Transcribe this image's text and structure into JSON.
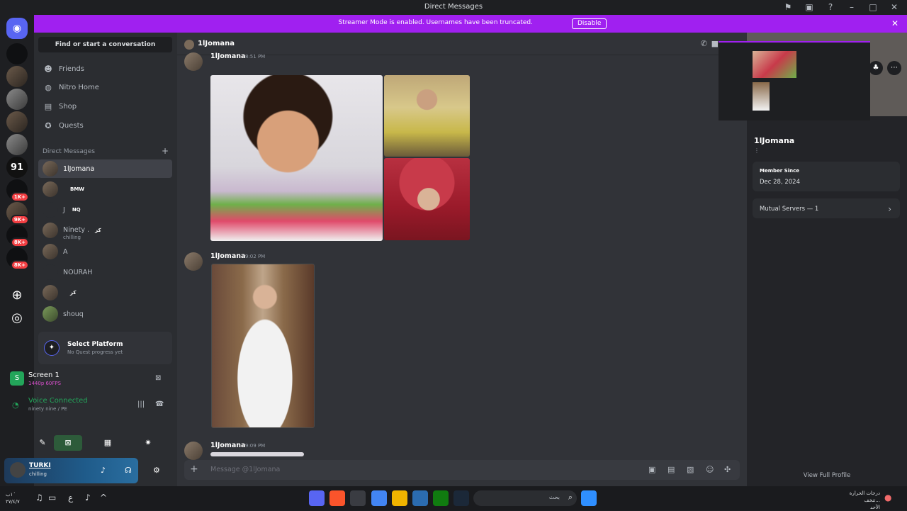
{
  "window": {
    "title": "Direct Messages"
  },
  "banner": {
    "message": "Streamer Mode is enabled. Usernames have been truncated.",
    "disable_label": "Disable"
  },
  "servers": {
    "badges": [
      "1K+",
      "9K+",
      "8K+",
      "8K+"
    ],
    "number_server": "91"
  },
  "sidebar": {
    "search_label": "Find or start a conversation",
    "nav": [
      {
        "label": "Friends",
        "icon": "friends-icon"
      },
      {
        "label": "Nitro Home",
        "icon": "nitro-icon"
      },
      {
        "label": "Shop",
        "icon": "shop-icon"
      },
      {
        "label": "Quests",
        "icon": "quests-icon"
      }
    ],
    "dm_header": "Direct Messages",
    "dms": [
      {
        "name": "1lJomana",
        "tag": "",
        "sub": ""
      },
      {
        "name": "",
        "tag": "BMW",
        "sub": ""
      },
      {
        "name": "J",
        "tag": "NQ",
        "sub": ""
      },
      {
        "name": "Ninety .",
        "tag": "كز",
        "sub": "chilling"
      },
      {
        "name": "A",
        "tag": "",
        "sub": ""
      },
      {
        "name": "NOURAH",
        "tag": "",
        "sub": ""
      },
      {
        "name": "",
        "tag": "كز",
        "sub": ""
      },
      {
        "name": "shouq",
        "tag": "",
        "sub": ""
      }
    ]
  },
  "quest": {
    "title": "Select Platform",
    "subtitle": "No Quest progress yet"
  },
  "stream": {
    "title": "Screen 1",
    "subtitle": "1440p 60FPS"
  },
  "voice": {
    "status": "Voice Connected",
    "channel": "ninety nine / PE"
  },
  "user": {
    "name": "TURKI",
    "status": "chilling"
  },
  "chat": {
    "recipient": "1lJomana",
    "messages": [
      {
        "author": "1lJomana",
        "time": "8:51 PM"
      },
      {
        "author": "1lJomana",
        "time": "9:02 PM"
      },
      {
        "author": "1lJomana",
        "time": "9:09 PM"
      }
    ],
    "composer_placeholder": "Message @1lJomana"
  },
  "profile": {
    "name": "1lJomana",
    "member_since_label": "Member Since",
    "member_since": "Dec 28, 2024",
    "mutual_servers": "Mutual Servers — 1",
    "view_full": "View Full Profile"
  },
  "taskbar": {
    "search_label": "بحث",
    "weather": "درجات الحرارة تنخف...",
    "weather_sub": "الأحد",
    "clock_time": "١ٰب",
    "clock_date": "٢٧/٤/٧"
  }
}
